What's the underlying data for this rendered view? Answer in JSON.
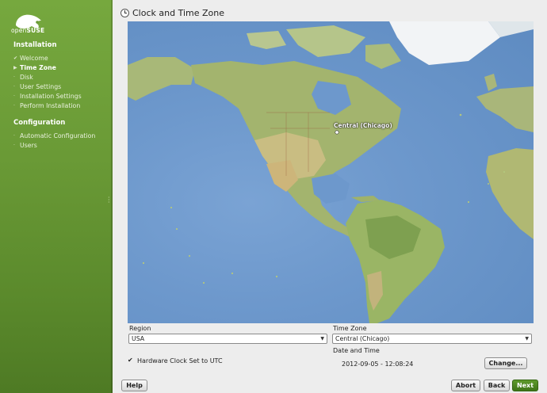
{
  "sidebar": {
    "logo": {
      "brand_prefix": "open",
      "brand_suffix": "SUSE"
    },
    "installation": {
      "title": "Installation",
      "steps": [
        {
          "label": "Welcome",
          "state": "done"
        },
        {
          "label": "Time Zone",
          "state": "current"
        },
        {
          "label": "Disk",
          "state": "todo"
        },
        {
          "label": "User Settings",
          "state": "todo"
        },
        {
          "label": "Installation Settings",
          "state": "todo"
        },
        {
          "label": "Perform Installation",
          "state": "todo"
        }
      ]
    },
    "configuration": {
      "title": "Configuration",
      "steps": [
        {
          "label": "Automatic Configuration",
          "state": "todo"
        },
        {
          "label": "Users",
          "state": "todo"
        }
      ]
    }
  },
  "header": {
    "title": "Clock and Time Zone",
    "icon": "clock-icon"
  },
  "map": {
    "selected_label": "Central (Chicago)"
  },
  "region": {
    "label": "Region",
    "value": "USA"
  },
  "timezone": {
    "label": "Time Zone",
    "value": "Central (Chicago)"
  },
  "hardware_clock": {
    "label": "Hardware Clock Set to UTC",
    "checked": true
  },
  "datetime": {
    "label": "Date and Time",
    "value": "2012-09-05 - 12:08:24"
  },
  "buttons": {
    "change": "Change...",
    "help": "Help",
    "abort": "Abort",
    "back": "Back",
    "next": "Next"
  },
  "colors": {
    "sidebar": "#6a9a36",
    "ocean": "#6d98cc",
    "next_button": "#4a8220"
  }
}
